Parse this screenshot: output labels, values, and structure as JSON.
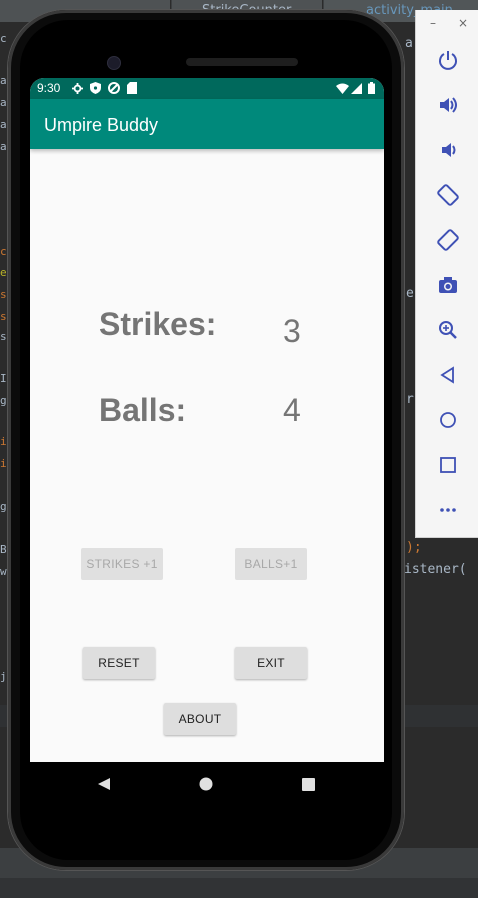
{
  "ide": {
    "tabs": [
      "",
      "StrikeCounter",
      "activity_main"
    ],
    "gutter_chars": [
      "c",
      "ar",
      "ar",
      "ar",
      "ar",
      "cl",
      "er",
      "se",
      "s",
      "s",
      "I",
      "g",
      "i",
      "i",
      "g",
      "B",
      "w",
      "j"
    ],
    "right_snippets": [
      "a",
      "e",
      "r",
      ");",
      "istener("
    ]
  },
  "emulator_toolbar": {
    "minimize_label": "–",
    "close_label": "×",
    "buttons": [
      "power-icon",
      "volume-up-icon",
      "volume-down-icon",
      "rotate-left-icon",
      "rotate-right-icon",
      "camera-icon",
      "zoom-icon",
      "back-icon",
      "home-icon",
      "overview-icon",
      "more-icon"
    ]
  },
  "status_bar": {
    "time": "9:30"
  },
  "app": {
    "title": "Umpire Buddy",
    "strikes_label": "Strikes:",
    "strikes_value": "3",
    "balls_label": "Balls:",
    "balls_value": "4",
    "strikes_button": "STRIKES +1",
    "balls_button": "BALLS+1",
    "reset_button": "RESET",
    "exit_button": "EXIT",
    "about_button": "ABOUT"
  },
  "colors": {
    "primary": "#00897b",
    "primary_dark": "#00695c",
    "text_gray": "#757575"
  }
}
